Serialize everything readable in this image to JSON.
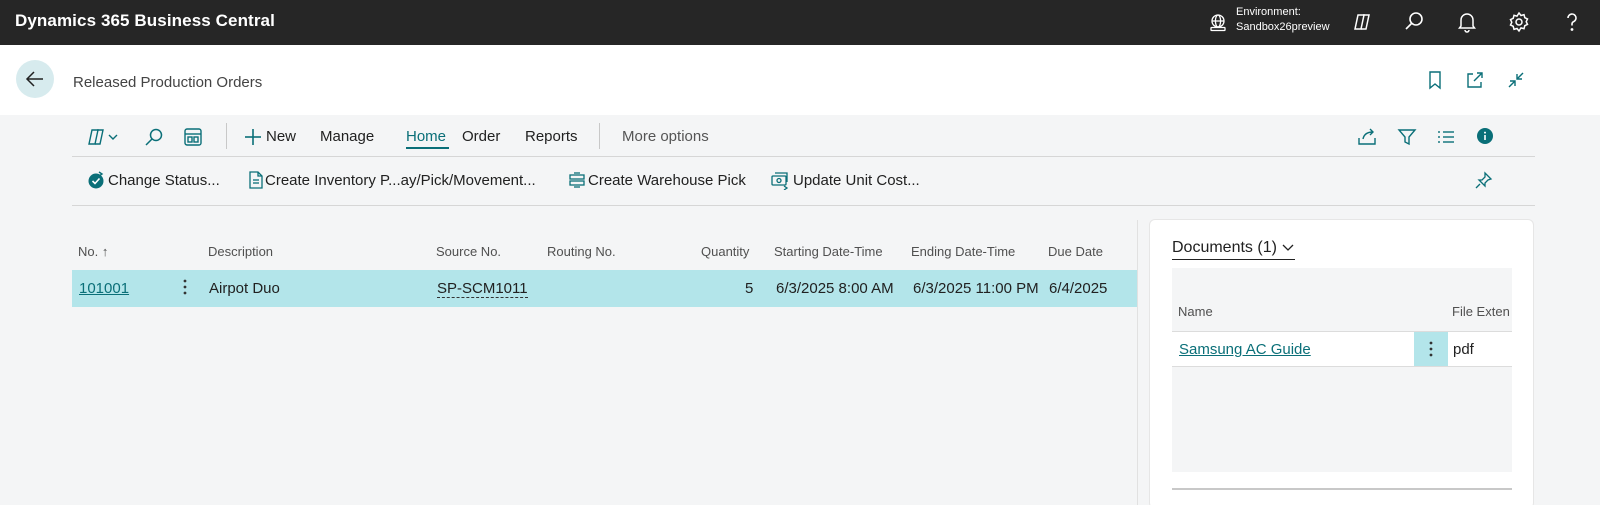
{
  "app": {
    "title": "Dynamics 365 Business Central"
  },
  "environment": {
    "label": "Environment:",
    "name": "Sandbox26preview"
  },
  "top_icons": [
    "copilot-icon",
    "search-icon",
    "bell-icon",
    "gear-icon",
    "help-icon"
  ],
  "page": {
    "title": "Released Production Orders"
  },
  "action_bar": {
    "new_label": "New",
    "tabs": [
      "Manage",
      "Home",
      "Order",
      "Reports"
    ],
    "active_tab": "Home",
    "more_label": "More options"
  },
  "promoted_actions": [
    "Change Status...",
    "Create Inventory P...ay/Pick/Movement...",
    "Create Warehouse Pick",
    "Update Unit Cost..."
  ],
  "list": {
    "columns": [
      "No.",
      "Description",
      "Source No.",
      "Routing No.",
      "Quantity",
      "Starting Date-Time",
      "Ending Date-Time",
      "Due Date"
    ],
    "sort_indicator": "↑",
    "rows": [
      {
        "no": "101001",
        "description": "Airpot Duo",
        "source_no": "SP-SCM1011",
        "routing_no": "",
        "quantity": "5",
        "starting": "6/3/2025 8:00 AM",
        "ending": "6/3/2025 11:00 PM",
        "due": "6/4/2025"
      }
    ]
  },
  "factbox": {
    "title": "Documents (1)",
    "columns": [
      "Name",
      "File Exten"
    ],
    "rows": [
      {
        "name": "Samsung AC Guide",
        "ext": "pdf"
      }
    ]
  },
  "colors": {
    "accent": "#0a6f78",
    "selected_row": "#b3e5ea",
    "topbar": "#262626"
  }
}
